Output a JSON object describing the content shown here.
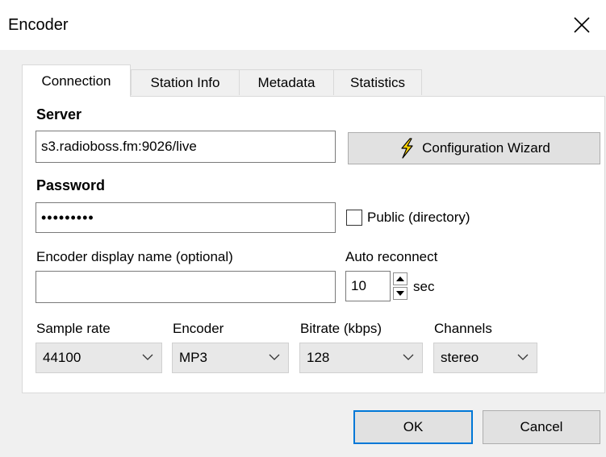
{
  "window": {
    "title": "Encoder"
  },
  "tabs": [
    {
      "label": "Connection"
    },
    {
      "label": "Station Info"
    },
    {
      "label": "Metadata"
    },
    {
      "label": "Statistics"
    }
  ],
  "connection": {
    "server_label": "Server",
    "server_value": "s3.radioboss.fm:9026/live",
    "wizard_label": "Configuration Wizard",
    "password_label": "Password",
    "password_value": "•••••••••",
    "public_label": "Public (directory)",
    "display_name_label": "Encoder display name (optional)",
    "display_name_value": "",
    "reconnect_label": "Auto reconnect",
    "reconnect_value": "10",
    "reconnect_unit": "sec",
    "sample_rate_label": "Sample rate",
    "sample_rate_value": "44100",
    "encoder_label": "Encoder",
    "encoder_value": "MP3",
    "bitrate_label": "Bitrate (kbps)",
    "bitrate_value": "128",
    "channels_label": "Channels",
    "channels_value": "stereo"
  },
  "footer": {
    "ok_label": "OK",
    "cancel_label": "Cancel"
  }
}
